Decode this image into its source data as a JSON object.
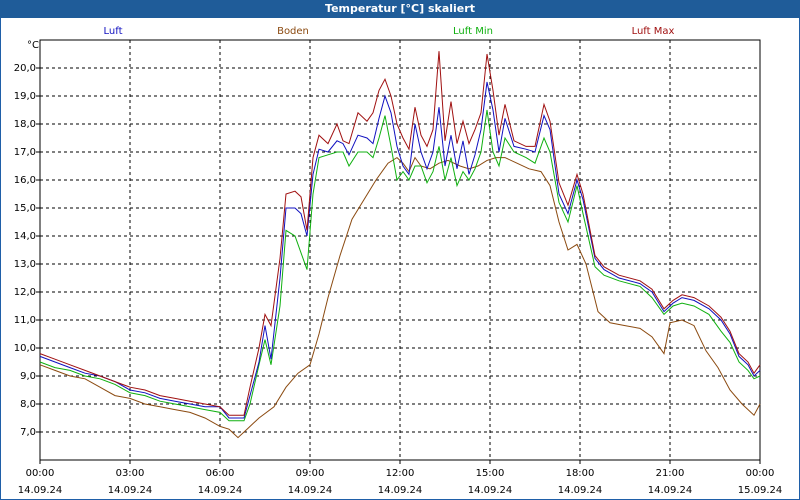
{
  "window": {
    "title": "Temperatur [°C] skaliert"
  },
  "chart_data": {
    "type": "line",
    "title": "Temperatur [°C] skaliert",
    "ylabel": "°C",
    "xlabel": "",
    "ylim": [
      6.0,
      21.0
    ],
    "xlim": [
      0,
      24
    ],
    "grid": true,
    "legend_placement": "top",
    "y_ticks": [
      "7,0",
      "8,0",
      "9,0",
      "10,0",
      "11,0",
      "12,0",
      "13,0",
      "14,0",
      "15,0",
      "16,0",
      "17,0",
      "18,0",
      "19,0",
      "20,0"
    ],
    "x_ticks": [
      {
        "time": "00:00",
        "date": "14.09.24"
      },
      {
        "time": "03:00",
        "date": "14.09.24"
      },
      {
        "time": "06:00",
        "date": "14.09.24"
      },
      {
        "time": "09:00",
        "date": "14.09.24"
      },
      {
        "time": "12:00",
        "date": "14.09.24"
      },
      {
        "time": "15:00",
        "date": "14.09.24"
      },
      {
        "time": "18:00",
        "date": "14.09.24"
      },
      {
        "time": "21:00",
        "date": "14.09.24"
      },
      {
        "time": "00:00",
        "date": "15.09.24"
      }
    ],
    "series": [
      {
        "name": "Luft",
        "color": "#1010c0",
        "points": [
          [
            0,
            9.7
          ],
          [
            0.5,
            9.5
          ],
          [
            1,
            9.3
          ],
          [
            1.5,
            9.1
          ],
          [
            2,
            9.0
          ],
          [
            2.5,
            8.8
          ],
          [
            3,
            8.5
          ],
          [
            3.5,
            8.4
          ],
          [
            4,
            8.2
          ],
          [
            4.5,
            8.1
          ],
          [
            5,
            8.0
          ],
          [
            5.5,
            7.9
          ],
          [
            6,
            7.9
          ],
          [
            6.3,
            7.5
          ],
          [
            6.8,
            7.5
          ],
          [
            7,
            8.3
          ],
          [
            7.3,
            9.5
          ],
          [
            7.5,
            10.8
          ],
          [
            7.7,
            9.6
          ],
          [
            8,
            12.5
          ],
          [
            8.2,
            15.0
          ],
          [
            8.5,
            15.0
          ],
          [
            8.7,
            14.8
          ],
          [
            8.9,
            14.0
          ],
          [
            9.1,
            16.2
          ],
          [
            9.3,
            17.1
          ],
          [
            9.6,
            17.0
          ],
          [
            9.9,
            17.4
          ],
          [
            10.1,
            17.3
          ],
          [
            10.3,
            16.9
          ],
          [
            10.6,
            17.6
          ],
          [
            10.9,
            17.5
          ],
          [
            11.1,
            17.3
          ],
          [
            11.3,
            18.2
          ],
          [
            11.5,
            19.0
          ],
          [
            11.7,
            18.4
          ],
          [
            11.9,
            17.2
          ],
          [
            12.1,
            16.5
          ],
          [
            12.3,
            16.2
          ],
          [
            12.5,
            18.0
          ],
          [
            12.7,
            17.0
          ],
          [
            12.9,
            16.4
          ],
          [
            13.1,
            17.0
          ],
          [
            13.3,
            18.6
          ],
          [
            13.5,
            16.5
          ],
          [
            13.7,
            17.6
          ],
          [
            13.9,
            16.4
          ],
          [
            14.1,
            17.4
          ],
          [
            14.3,
            16.2
          ],
          [
            14.5,
            16.9
          ],
          [
            14.7,
            17.8
          ],
          [
            14.9,
            19.5
          ],
          [
            15.1,
            18.5
          ],
          [
            15.3,
            17.0
          ],
          [
            15.5,
            18.2
          ],
          [
            15.8,
            17.2
          ],
          [
            16.2,
            17.1
          ],
          [
            16.5,
            17.0
          ],
          [
            16.8,
            18.3
          ],
          [
            17.0,
            17.8
          ],
          [
            17.3,
            15.5
          ],
          [
            17.6,
            14.8
          ],
          [
            17.9,
            16.0
          ],
          [
            18.1,
            15.3
          ],
          [
            18.5,
            13.2
          ],
          [
            18.8,
            12.8
          ],
          [
            19.3,
            12.5
          ],
          [
            20,
            12.3
          ],
          [
            20.4,
            12.0
          ],
          [
            20.8,
            11.3
          ],
          [
            21.1,
            11.6
          ],
          [
            21.4,
            11.8
          ],
          [
            21.8,
            11.7
          ],
          [
            22.3,
            11.4
          ],
          [
            22.7,
            11.0
          ],
          [
            23,
            10.5
          ],
          [
            23.3,
            9.7
          ],
          [
            23.6,
            9.4
          ],
          [
            23.8,
            9.0
          ],
          [
            24,
            9.2
          ]
        ]
      },
      {
        "name": "Boden",
        "color": "#8b4a10",
        "points": [
          [
            0,
            9.4
          ],
          [
            0.5,
            9.2
          ],
          [
            1,
            9.0
          ],
          [
            1.5,
            8.9
          ],
          [
            2,
            8.6
          ],
          [
            2.5,
            8.3
          ],
          [
            3,
            8.2
          ],
          [
            3.5,
            8.0
          ],
          [
            4,
            7.9
          ],
          [
            4.5,
            7.8
          ],
          [
            5,
            7.7
          ],
          [
            5.5,
            7.5
          ],
          [
            6,
            7.2
          ],
          [
            6.3,
            7.1
          ],
          [
            6.6,
            6.8
          ],
          [
            6.9,
            7.1
          ],
          [
            7.3,
            7.5
          ],
          [
            7.8,
            7.9
          ],
          [
            8.2,
            8.6
          ],
          [
            8.6,
            9.1
          ],
          [
            9.0,
            9.4
          ],
          [
            9.3,
            10.5
          ],
          [
            9.6,
            11.8
          ],
          [
            10.0,
            13.3
          ],
          [
            10.4,
            14.6
          ],
          [
            10.8,
            15.3
          ],
          [
            11.2,
            16.0
          ],
          [
            11.6,
            16.6
          ],
          [
            11.9,
            16.8
          ],
          [
            12.1,
            16.6
          ],
          [
            12.3,
            16.3
          ],
          [
            12.5,
            16.8
          ],
          [
            12.7,
            16.5
          ],
          [
            13,
            16.4
          ],
          [
            13.3,
            16.6
          ],
          [
            13.6,
            16.7
          ],
          [
            14,
            16.5
          ],
          [
            14.3,
            16.4
          ],
          [
            14.6,
            16.5
          ],
          [
            14.9,
            16.7
          ],
          [
            15.2,
            16.8
          ],
          [
            15.5,
            16.8
          ],
          [
            15.9,
            16.6
          ],
          [
            16.3,
            16.4
          ],
          [
            16.7,
            16.3
          ],
          [
            17.0,
            15.8
          ],
          [
            17.3,
            14.5
          ],
          [
            17.6,
            13.5
          ],
          [
            17.9,
            13.7
          ],
          [
            18.2,
            13.0
          ],
          [
            18.6,
            11.3
          ],
          [
            19.0,
            10.9
          ],
          [
            19.5,
            10.8
          ],
          [
            20,
            10.7
          ],
          [
            20.4,
            10.4
          ],
          [
            20.8,
            9.8
          ],
          [
            21.0,
            10.9
          ],
          [
            21.4,
            11.0
          ],
          [
            21.8,
            10.8
          ],
          [
            22.2,
            9.9
          ],
          [
            22.6,
            9.3
          ],
          [
            23.0,
            8.5
          ],
          [
            23.4,
            8.0
          ],
          [
            23.8,
            7.6
          ],
          [
            24,
            8.0
          ]
        ]
      },
      {
        "name": "Luft Min",
        "color": "#10b010",
        "points": [
          [
            0,
            9.5
          ],
          [
            0.5,
            9.3
          ],
          [
            1,
            9.2
          ],
          [
            1.5,
            9.0
          ],
          [
            2,
            8.9
          ],
          [
            2.5,
            8.7
          ],
          [
            3,
            8.4
          ],
          [
            3.5,
            8.3
          ],
          [
            4,
            8.1
          ],
          [
            4.5,
            8.0
          ],
          [
            5,
            7.9
          ],
          [
            5.5,
            7.8
          ],
          [
            6,
            7.7
          ],
          [
            6.3,
            7.4
          ],
          [
            6.8,
            7.4
          ],
          [
            7,
            8.0
          ],
          [
            7.3,
            9.4
          ],
          [
            7.5,
            10.3
          ],
          [
            7.7,
            9.4
          ],
          [
            8,
            11.5
          ],
          [
            8.2,
            14.2
          ],
          [
            8.5,
            14.0
          ],
          [
            8.7,
            13.4
          ],
          [
            8.9,
            12.8
          ],
          [
            9.1,
            15.5
          ],
          [
            9.3,
            16.8
          ],
          [
            9.6,
            16.9
          ],
          [
            9.9,
            17.0
          ],
          [
            10.1,
            17.0
          ],
          [
            10.3,
            16.5
          ],
          [
            10.6,
            17.0
          ],
          [
            10.9,
            17.0
          ],
          [
            11.1,
            16.8
          ],
          [
            11.3,
            17.5
          ],
          [
            11.5,
            18.3
          ],
          [
            11.7,
            17.2
          ],
          [
            11.9,
            16.0
          ],
          [
            12.1,
            16.3
          ],
          [
            12.3,
            16.0
          ],
          [
            12.5,
            16.5
          ],
          [
            12.7,
            16.5
          ],
          [
            12.9,
            15.9
          ],
          [
            13.1,
            16.3
          ],
          [
            13.3,
            17.2
          ],
          [
            13.5,
            16.0
          ],
          [
            13.7,
            16.8
          ],
          [
            13.9,
            15.8
          ],
          [
            14.1,
            16.3
          ],
          [
            14.3,
            16.0
          ],
          [
            14.5,
            16.4
          ],
          [
            14.7,
            17.0
          ],
          [
            14.9,
            18.5
          ],
          [
            15.1,
            17.0
          ],
          [
            15.3,
            16.5
          ],
          [
            15.5,
            17.5
          ],
          [
            15.8,
            17.0
          ],
          [
            16.2,
            16.8
          ],
          [
            16.5,
            16.6
          ],
          [
            16.8,
            17.5
          ],
          [
            17.0,
            17.0
          ],
          [
            17.3,
            15.2
          ],
          [
            17.6,
            14.5
          ],
          [
            17.9,
            15.8
          ],
          [
            18.1,
            14.8
          ],
          [
            18.5,
            12.9
          ],
          [
            18.8,
            12.6
          ],
          [
            19.3,
            12.4
          ],
          [
            20,
            12.2
          ],
          [
            20.4,
            11.8
          ],
          [
            20.8,
            11.2
          ],
          [
            21.1,
            11.5
          ],
          [
            21.4,
            11.6
          ],
          [
            21.8,
            11.5
          ],
          [
            22.3,
            11.2
          ],
          [
            22.7,
            10.6
          ],
          [
            23,
            10.2
          ],
          [
            23.3,
            9.5
          ],
          [
            23.6,
            9.2
          ],
          [
            23.8,
            8.9
          ],
          [
            24,
            9.0
          ]
        ]
      },
      {
        "name": "Luft Max",
        "color": "#a01010",
        "points": [
          [
            0,
            9.8
          ],
          [
            0.5,
            9.6
          ],
          [
            1,
            9.4
          ],
          [
            1.5,
            9.2
          ],
          [
            2,
            9.0
          ],
          [
            2.5,
            8.8
          ],
          [
            3,
            8.6
          ],
          [
            3.5,
            8.5
          ],
          [
            4,
            8.3
          ],
          [
            4.5,
            8.2
          ],
          [
            5,
            8.1
          ],
          [
            5.5,
            8.0
          ],
          [
            6,
            7.9
          ],
          [
            6.3,
            7.6
          ],
          [
            6.8,
            7.6
          ],
          [
            7,
            8.6
          ],
          [
            7.3,
            10.0
          ],
          [
            7.5,
            11.2
          ],
          [
            7.7,
            10.8
          ],
          [
            8,
            13.2
          ],
          [
            8.2,
            15.5
          ],
          [
            8.5,
            15.6
          ],
          [
            8.7,
            15.4
          ],
          [
            8.9,
            14.2
          ],
          [
            9.1,
            16.8
          ],
          [
            9.3,
            17.6
          ],
          [
            9.6,
            17.3
          ],
          [
            9.9,
            18.0
          ],
          [
            10.1,
            17.4
          ],
          [
            10.3,
            17.3
          ],
          [
            10.6,
            18.4
          ],
          [
            10.9,
            18.1
          ],
          [
            11.1,
            18.4
          ],
          [
            11.3,
            19.2
          ],
          [
            11.5,
            19.6
          ],
          [
            11.7,
            19.0
          ],
          [
            11.9,
            18.0
          ],
          [
            12.1,
            17.5
          ],
          [
            12.3,
            17.1
          ],
          [
            12.5,
            18.6
          ],
          [
            12.7,
            17.6
          ],
          [
            12.9,
            17.2
          ],
          [
            13.1,
            17.8
          ],
          [
            13.3,
            20.6
          ],
          [
            13.5,
            17.4
          ],
          [
            13.7,
            18.8
          ],
          [
            13.9,
            17.3
          ],
          [
            14.1,
            18.1
          ],
          [
            14.3,
            17.3
          ],
          [
            14.5,
            17.8
          ],
          [
            14.7,
            18.4
          ],
          [
            14.9,
            20.5
          ],
          [
            15.1,
            19.2
          ],
          [
            15.3,
            17.6
          ],
          [
            15.5,
            18.7
          ],
          [
            15.8,
            17.4
          ],
          [
            16.2,
            17.2
          ],
          [
            16.5,
            17.2
          ],
          [
            16.8,
            18.7
          ],
          [
            17.0,
            18.1
          ],
          [
            17.3,
            15.9
          ],
          [
            17.6,
            15.1
          ],
          [
            17.9,
            16.2
          ],
          [
            18.1,
            15.5
          ],
          [
            18.5,
            13.3
          ],
          [
            18.8,
            12.9
          ],
          [
            19.3,
            12.6
          ],
          [
            20,
            12.4
          ],
          [
            20.4,
            12.1
          ],
          [
            20.8,
            11.4
          ],
          [
            21.1,
            11.7
          ],
          [
            21.4,
            11.9
          ],
          [
            21.8,
            11.8
          ],
          [
            22.3,
            11.5
          ],
          [
            22.7,
            11.1
          ],
          [
            23,
            10.6
          ],
          [
            23.3,
            9.8
          ],
          [
            23.6,
            9.5
          ],
          [
            23.8,
            9.1
          ],
          [
            24,
            9.4
          ]
        ]
      }
    ]
  }
}
